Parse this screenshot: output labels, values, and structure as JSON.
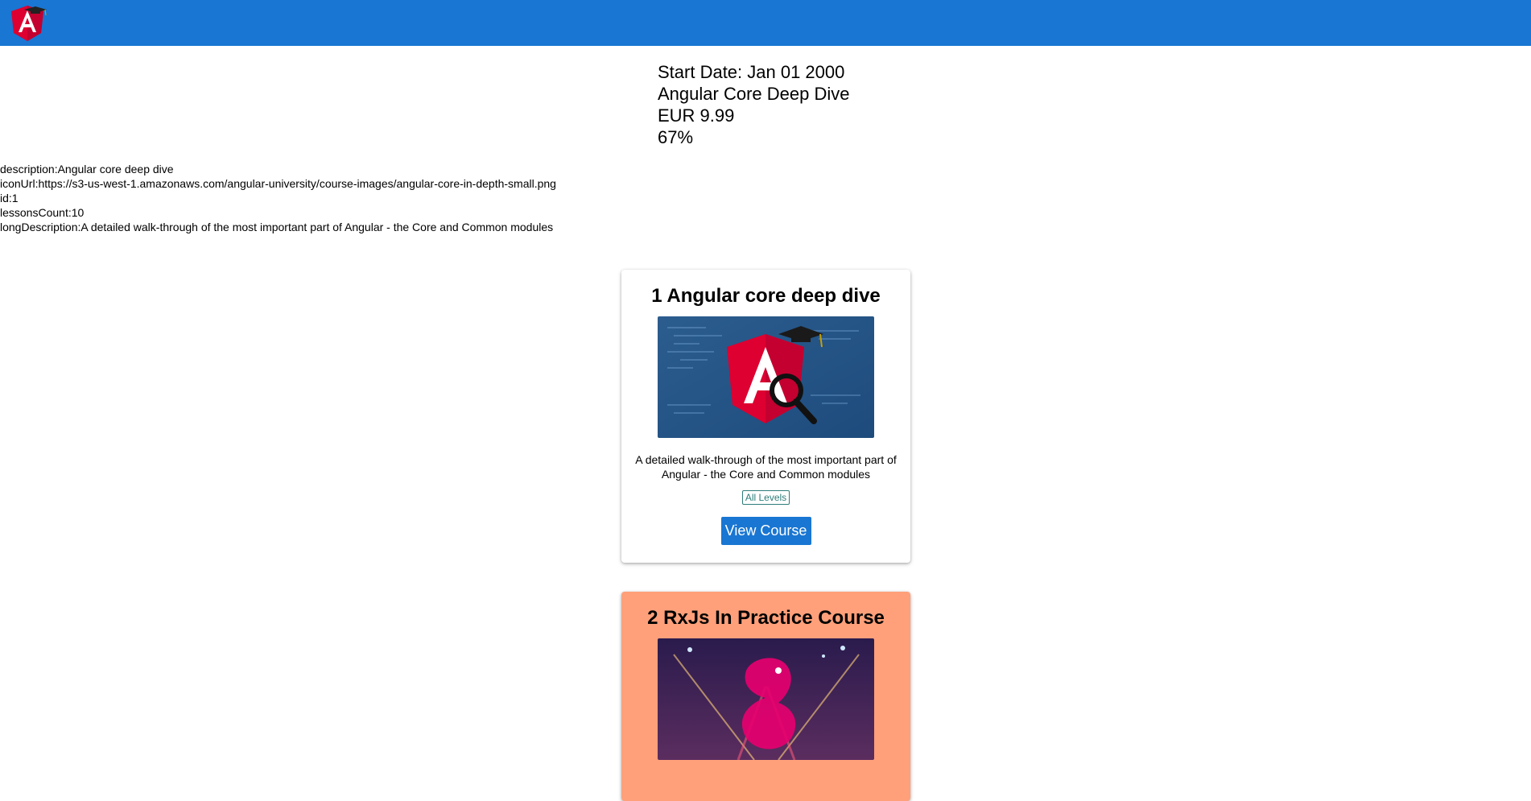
{
  "topbar": {
    "color": "#1976d2",
    "logo_icon": "angular-graduation-cap-logo-icon"
  },
  "summary": {
    "start_date": "Start Date: Jan 01 2000",
    "title": "Angular Core Deep Dive",
    "price": "EUR 9.99",
    "percent": "67%"
  },
  "details": [
    "description:Angular core deep dive",
    "iconUrl:https://s3-us-west-1.amazonaws.com/angular-university/course-images/angular-core-in-depth-small.png",
    "id:1",
    "lessonsCount:10",
    "longDescription:A detailed walk-through of the most important part of Angular - the Core and Common modules"
  ],
  "courses": [
    {
      "title": "1 Angular core deep dive",
      "image_icon": "angular-magnifier-icon",
      "description": "A detailed walk-through of the most important part of Angular - the Core and Common modules",
      "level": "All Levels",
      "button": "View Course",
      "background": "#ffffff"
    },
    {
      "title": "2 RxJs In Practice Course",
      "image_icon": "rxjs-logo-icon",
      "background": "#ffa07a"
    }
  ]
}
